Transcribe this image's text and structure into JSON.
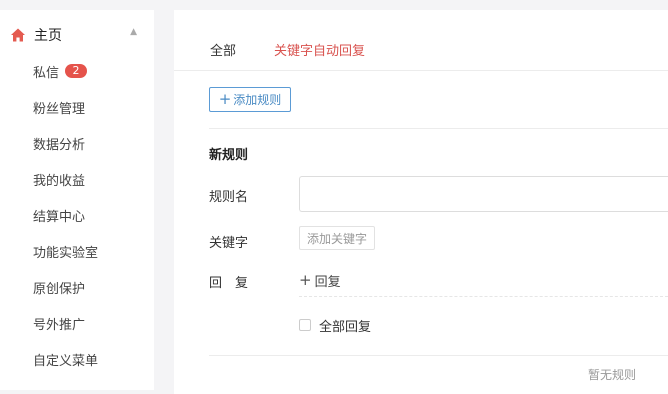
{
  "sidebar": {
    "home": {
      "label": "主页",
      "icon": "home-icon",
      "expanded": true
    },
    "items": [
      {
        "label": "私信",
        "badge": "2"
      },
      {
        "label": "粉丝管理"
      },
      {
        "label": "数据分析"
      },
      {
        "label": "我的收益"
      },
      {
        "label": "结算中心"
      },
      {
        "label": "功能实验室"
      },
      {
        "label": "原创保护"
      },
      {
        "label": "号外推广"
      },
      {
        "label": "自定义菜单"
      }
    ]
  },
  "main": {
    "tabs": [
      {
        "label": "全部",
        "active": false
      },
      {
        "label": "关键字自动回复",
        "active": true
      }
    ],
    "add_rule_button": "添加规则",
    "section_title": "新规则",
    "fields": {
      "rule_name_label": "规则名",
      "rule_name_value": "",
      "keyword_label": "关键字",
      "add_keyword_button": "添加关键字",
      "reply_label": "回　复",
      "add_reply_link": "回复",
      "reply_all_label": "全部回复",
      "reply_all_checked": false
    },
    "empty_text": "暂无规则"
  },
  "colors": {
    "accent_red": "#d9534f",
    "badge_red": "#e5534b",
    "link_blue": "#4a8bc4",
    "home_icon": "#e45b50"
  }
}
